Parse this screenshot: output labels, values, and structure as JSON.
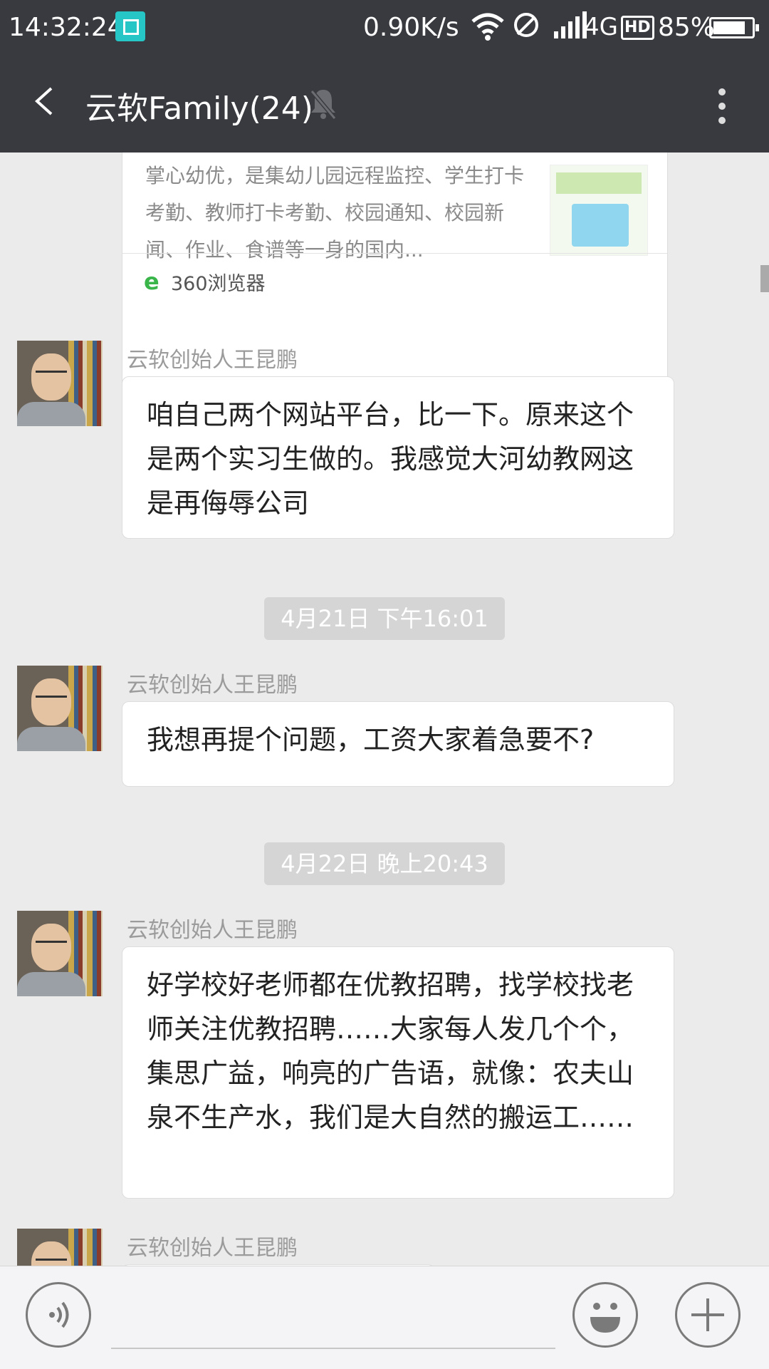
{
  "status_bar": {
    "time": "14:32:24",
    "network_speed": "0.90K/s",
    "network_type": "4G",
    "hd_badge": "HD",
    "battery_percent": "85%",
    "battery_level": 0.85
  },
  "header": {
    "title": "云软Family(24)",
    "icons": [
      "back-arrow-icon",
      "mute-bell-icon",
      "more-vertical-icon"
    ]
  },
  "chat": {
    "link_card": {
      "description": "掌心幼优，是集幼儿园远程监控、学生打卡考勤、教师打卡考勤、校园通知、校园新闻、作业、食谱等一身的国内...",
      "source": "360浏览器"
    },
    "messages": [
      {
        "sender": "云软创始人王昆鹏",
        "text": "咱自己两个网站平台，比一下。原来这个是两个实习生做的。我感觉大河幼教网这是再侮辱公司"
      },
      {
        "timestamp": "4月21日 下午16:01"
      },
      {
        "sender": "云软创始人王昆鹏",
        "text": "我想再提个问题，工资大家着急要不?"
      },
      {
        "timestamp": "4月22日 晚上20:43"
      },
      {
        "sender": "云软创始人王昆鹏",
        "text": "好学校好老师都在优教招聘，找学校找老师关注优教招聘……大家每人发几个个，集思广益，响亮的广告语，就像：农夫山泉不生产水，我们是大自然的搬运工……"
      },
      {
        "sender": "云软创始人王昆鹏",
        "text": ""
      }
    ]
  },
  "input_bar": {
    "icons": [
      "voice-icon",
      "emoji-icon",
      "plus-icon"
    ]
  },
  "colors": {
    "header_bg": "#393a3f",
    "chat_bg": "#ebebeb",
    "timestamp_bg": "#d5d5d5"
  }
}
